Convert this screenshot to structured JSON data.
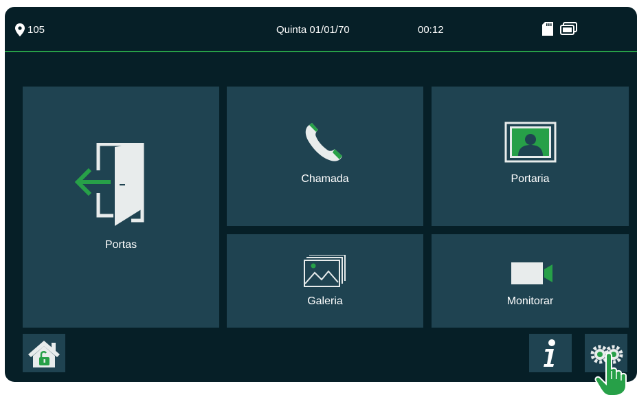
{
  "status_bar": {
    "apartment": "105",
    "date": "Quinta 01/01/70",
    "time": "00:12",
    "icons": [
      "location-pin-icon",
      "sd-card-icon",
      "screens-icon"
    ]
  },
  "tiles": {
    "portas": {
      "label": "Portas",
      "icon": "door-exit-icon"
    },
    "chamada": {
      "label": "Chamada",
      "icon": "phone-icon"
    },
    "portaria": {
      "label": "Portaria",
      "icon": "concierge-contact-icon"
    },
    "galeria": {
      "label": "Galeria",
      "icon": "gallery-icon"
    },
    "monitorar": {
      "label": "Monitorar",
      "icon": "video-camera-icon"
    }
  },
  "bottom_bar": {
    "icons": [
      "home-unlock-icon",
      "info-icon",
      "settings-gears-icon",
      "hand-pointer-icon"
    ]
  },
  "colors": {
    "background": "#061f27",
    "tile": "#1f4351",
    "accent": "#27a048",
    "icon": "#e8ecec"
  }
}
